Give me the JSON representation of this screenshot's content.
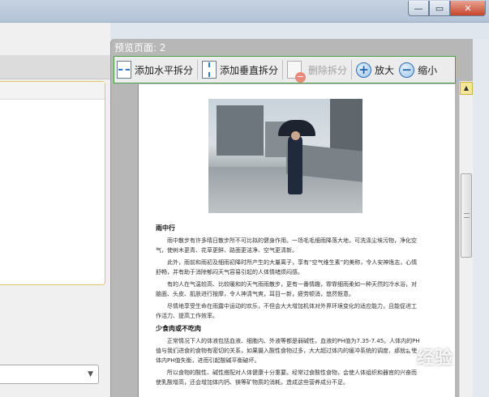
{
  "window": {
    "minimize_glyph": "—",
    "maximize_glyph": "▭",
    "close_glyph": "✕"
  },
  "preview": {
    "title": "预览页面: 2"
  },
  "toolbar": {
    "add_horizontal": "添加水平拆分",
    "add_vertical": "添加垂直拆分",
    "delete_split": "删除拆分",
    "zoom_in": "放大",
    "zoom_out": "缩小",
    "zoom_in_glyph": "+",
    "zoom_out_glyph": "−"
  },
  "scrollbar": {
    "up_glyph": "▲"
  },
  "left_select": {
    "arrow_glyph": "▼"
  },
  "document": {
    "heading1": "雨中行",
    "p1": "雨中散步有许多晴日散步所不可比拟的健身作用。一场毛毛细雨降落大地，可洗涤尘埃污物，净化空气，使树木更青、花草更鲜、路面更洁净、空气更清新。",
    "p2": "此外，雨前和雨初及细雨初降时所产生的大量离子，享有“空气维生素”的美称，令人安神逸志，心情舒畅，并有助于消除郁闷天气容易引起的人体情绪烦闷感。",
    "p3": "有的人在气温较高、比较暖和的天气雨雨散步，更有一番情趣，霏霏细雨柔如一种天然的冷水浴，对脑面、头皮、肌肤进行按摩，令人神清气爽，耳目一新，疲劳顿消，悠然惬意。",
    "p4": "尽情地享受生命在雨露中运动的欢乐，不但会大大增加机体对外界环境变化的适应能力，且能促进工作活力、提高工作效率。",
    "heading2": "少食肉或不吃肉",
    "p5": "正常情况下人的体液包括血液、细胞内、外液等都是弱碱性，血液的PH值为7.35-7.45。人体内的PH值与我们进食的食物有密切的关系，如果摄入酸性食物过多，大大超过体内的缓冲系统的调度，那就会使体内PH值失衡，进而引起酸碱平衡破坏。",
    "p6": "所以食物的酸性、碱性搭配对人体健康十分重要。经常过食酸性食物，会使人体组织和器官的兴奋而使乳酸增高，还会增加体内钙、镁等矿物质的消耗，造成这些营养成分不足。"
  },
  "watermark": {
    "text": "经验"
  }
}
